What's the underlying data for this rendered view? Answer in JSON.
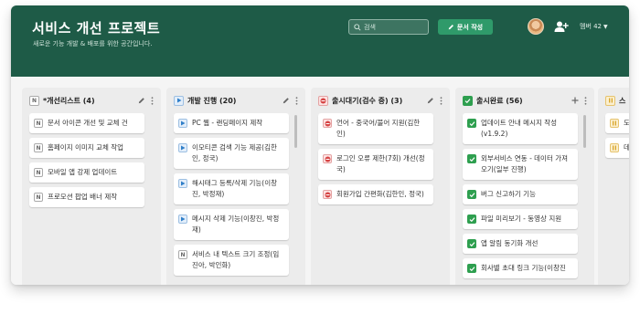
{
  "header": {
    "title": "서비스 개선 프로젝트",
    "subtitle": "새로운 기능 개발 & 배포를 위한 공간입니다.",
    "search_placeholder": "검색",
    "new_doc_label": "문서 작성",
    "member_label": "멤버 42"
  },
  "colors": {
    "header_bg": "#1e5b47",
    "primary_button": "#2f9a6a",
    "done_check": "#2e9f4f",
    "progress_play": "#2f7fc9",
    "waiting_stop": "#d64545",
    "paused": "#d9a62c"
  },
  "columns": [
    {
      "title": "*개선리스트 (4)",
      "status_icon": "note-icon",
      "actions": [
        "edit-icon",
        "more-icon"
      ],
      "cards": [
        {
          "text": "문서 아이콘 개선 및 교체 건",
          "icon": "note-icon"
        },
        {
          "text": "홈페이지 이미지 교체 작업",
          "icon": "note-icon"
        },
        {
          "text": "모바일 앱 강제 업데이트",
          "icon": "note-icon"
        },
        {
          "text": "프로모션 팝업 배너 제작",
          "icon": "note-icon"
        }
      ]
    },
    {
      "title": "개발 진행 (20)",
      "status_icon": "play-icon",
      "actions": [
        "edit-icon",
        "more-icon"
      ],
      "cards": [
        {
          "text": "PC 웹 - 랜딩페이지 제작",
          "icon": "play-icon"
        },
        {
          "text": "이모티콘 검색 기능 제공(김한인, 정국)",
          "icon": "play-icon"
        },
        {
          "text": "해시태그 등록/삭제 기능(이창진, 박정재)",
          "icon": "play-icon"
        },
        {
          "text": "메시지 삭제 기능(이창진, 박정재)",
          "icon": "play-icon"
        },
        {
          "text": "서비스 내 텍스트 크기 조정(임진아, 박인화)",
          "icon": "note-icon"
        }
      ]
    },
    {
      "title": "출시대기(검수 중) (3)",
      "status_icon": "stop-icon",
      "actions": [
        "edit-icon",
        "more-icon"
      ],
      "cards": [
        {
          "text": "언어 - 중국어/불어 지원(김한인)",
          "icon": "stop-icon"
        },
        {
          "text": "로그인 오류 제한(7회) 개선(정국)",
          "icon": "stop-icon"
        },
        {
          "text": "회원가입 간편화(김한인, 정국)",
          "icon": "stop-icon"
        }
      ]
    },
    {
      "title": "출시완료 (56)",
      "status_icon": "check-icon",
      "actions": [
        "add-icon",
        "more-icon"
      ],
      "cards": [
        {
          "text": "업데이트 안내 메시지 작성 (v1.9.2)",
          "icon": "check-icon"
        },
        {
          "text": "외부서비스 연동 - 데이터 가져오기(일부 진행)",
          "icon": "check-icon"
        },
        {
          "text": "버그 신고하기 기능",
          "icon": "check-icon"
        },
        {
          "text": "파일 미리보기 - 동영상 지원",
          "icon": "check-icon"
        },
        {
          "text": "앱 알림 동기화 개선",
          "icon": "check-icon"
        },
        {
          "text": "회사별 초대 링크 기능(이창진",
          "icon": "check-icon"
        }
      ]
    },
    {
      "title": "스",
      "status_icon": "pause-icon",
      "actions": [],
      "cards": [
        {
          "text": "도",
          "icon": "pause-icon"
        },
        {
          "text": "데",
          "icon": "pause-icon"
        }
      ]
    }
  ]
}
